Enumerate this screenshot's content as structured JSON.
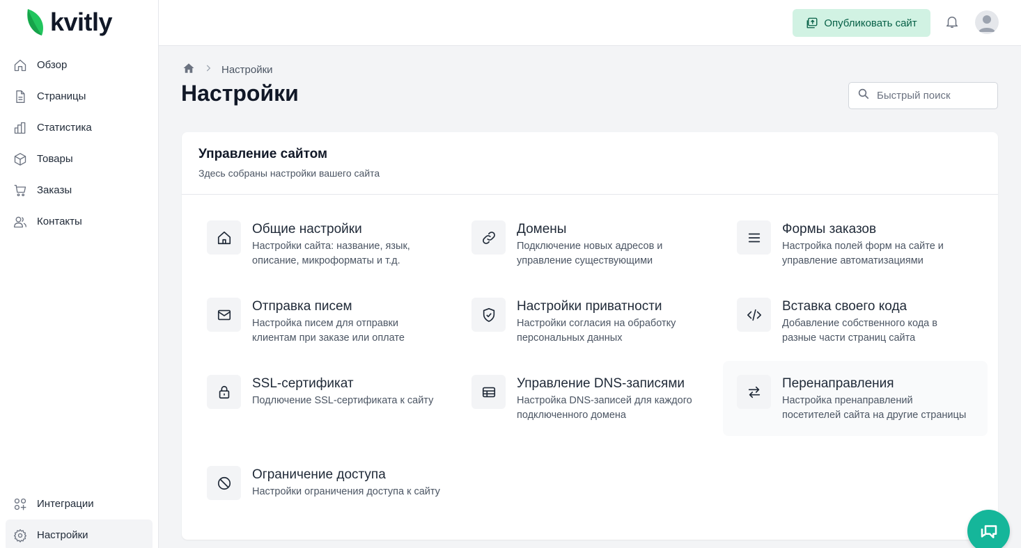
{
  "brand": {
    "name": "kvitly",
    "accent": "#22c55e"
  },
  "sidebar": {
    "items": [
      {
        "label": "Обзор",
        "icon": "home-icon"
      },
      {
        "label": "Страницы",
        "icon": "document-icon"
      },
      {
        "label": "Статистика",
        "icon": "chart-icon"
      },
      {
        "label": "Товары",
        "icon": "cube-icon"
      },
      {
        "label": "Заказы",
        "icon": "cart-icon"
      },
      {
        "label": "Контакты",
        "icon": "users-icon"
      }
    ],
    "bottom_items": [
      {
        "label": "Интеграции",
        "icon": "integrations-icon"
      },
      {
        "label": "Настройки",
        "icon": "gear-icon",
        "active": true
      }
    ]
  },
  "topbar": {
    "publish_label": "Опубликовать сайт"
  },
  "breadcrumb": {
    "current": "Настройки"
  },
  "page": {
    "title": "Настройки"
  },
  "search": {
    "placeholder": "Быстрый поиск"
  },
  "card": {
    "title": "Управление сайтом",
    "subtitle": "Здесь собраны настройки вашего сайта",
    "tiles": [
      {
        "title": "Общие настройки",
        "desc": "Настройки сайта: название, язык, описание, микроформаты и т.д.",
        "icon": "home-icon"
      },
      {
        "title": "Домены",
        "desc": "Подключение новых адресов и управление существующими",
        "icon": "link-icon"
      },
      {
        "title": "Формы заказов",
        "desc": "Настройка полей форм на сайте и управление автоматизациями",
        "icon": "menu-icon"
      },
      {
        "title": "Отправка писем",
        "desc": "Настройка писем для отправки клиентам при заказе или оплате",
        "icon": "mail-icon"
      },
      {
        "title": "Настройки приватности",
        "desc": "Настройки согласия на обработку персональных данных",
        "icon": "shield-check-icon"
      },
      {
        "title": "Вставка своего кода",
        "desc": "Добавление собственного кода в разные части страниц сайта",
        "icon": "code-icon"
      },
      {
        "title": "SSL-сертификат",
        "desc": "Подлючение SSL-сертификата к сайту",
        "icon": "lock-icon"
      },
      {
        "title": "Управление DNS-записями",
        "desc": "Настройка DNS-записей для каждого подключенного домена",
        "icon": "server-icon"
      },
      {
        "title": "Перенаправления",
        "desc": "Настройка пренаправлений посетителей сайта на другие страницы",
        "icon": "arrows-swap-icon"
      },
      {
        "title": "Ограничение доступа",
        "desc": "Настройки ограничения доступа к сайту",
        "icon": "ban-icon"
      }
    ]
  }
}
